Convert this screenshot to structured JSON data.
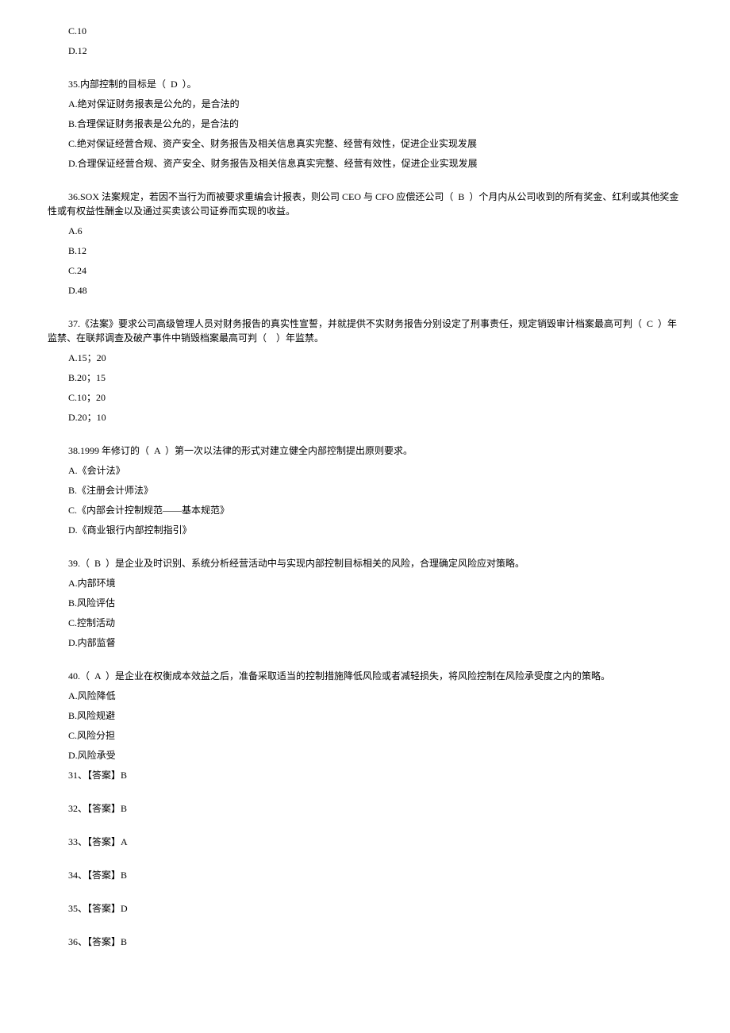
{
  "lines": [
    {
      "text": "C.10",
      "indent": true
    },
    {
      "text": "D.12",
      "indent": true
    },
    {
      "text": "",
      "gap": true
    },
    {
      "text": "35.内部控制的目标是（  D  ）。",
      "indent": true
    },
    {
      "text": "A.绝对保证财务报表是公允的，是合法的",
      "indent": true
    },
    {
      "text": "B.合理保证财务报表是公允的，是合法的",
      "indent": true
    },
    {
      "text": "C.绝对保证经营合规、资产安全、财务报告及相关信息真实完整、经营有效性，促进企业实现发展",
      "indent": true
    },
    {
      "text": "D.合理保证经营合规、资产安全、财务报告及相关信息真实完整、经营有效性，促进企业实现发展",
      "indent": true
    },
    {
      "text": "",
      "gap": true
    },
    {
      "text": "36.SOX 法案规定，若因不当行为而被要求重编会计报表，则公司 CEO 与 CFO 应偿还公司（  B  ）个月内从公司收到的所有奖金、红利或其他奖金性或有权益性酬金以及通过买卖该公司证券而实现的收益。",
      "indent": true,
      "wrap": true
    },
    {
      "text": "A.6",
      "indent": true
    },
    {
      "text": "B.12",
      "indent": true
    },
    {
      "text": "C.24",
      "indent": true
    },
    {
      "text": "D.48",
      "indent": true
    },
    {
      "text": "",
      "gap": true
    },
    {
      "text": "37.《法案》要求公司高级管理人员对财务报告的真实性宣誓，并就提供不实财务报告分别设定了刑事责任，规定销毁审计档案最高可判（  C  ）年监禁、在联邦调查及破产事件中销毁档案最高可判（    ）年监禁。",
      "indent": true,
      "wrap": true
    },
    {
      "text": "A.15；20",
      "indent": true
    },
    {
      "text": "B.20；15",
      "indent": true
    },
    {
      "text": "C.10；20",
      "indent": true
    },
    {
      "text": "D.20；10",
      "indent": true
    },
    {
      "text": "",
      "gap": true
    },
    {
      "text": "38.1999 年修订的（  A  ）第一次以法律的形式对建立健全内部控制提出原则要求。",
      "indent": true
    },
    {
      "text": "A.《会计法》",
      "indent": true
    },
    {
      "text": "B.《注册会计师法》",
      "indent": true
    },
    {
      "text": "C.《内部会计控制规范——基本规范》",
      "indent": true
    },
    {
      "text": "D.《商业银行内部控制指引》",
      "indent": true
    },
    {
      "text": "",
      "gap": true
    },
    {
      "text": "39.（  B  ）是企业及时识别、系统分析经营活动中与实现内部控制目标相关的风险，合理确定风险应对策略。",
      "indent": true
    },
    {
      "text": "A.内部环境",
      "indent": true
    },
    {
      "text": "B.风险评估",
      "indent": true
    },
    {
      "text": "C.控制活动",
      "indent": true
    },
    {
      "text": "D.内部监督",
      "indent": true
    },
    {
      "text": "",
      "gap": true
    },
    {
      "text": "40.（  A  ）是企业在权衡成本效益之后，准备采取适当的控制措施降低风险或者减轻损失，将风险控制在风险承受度之内的策略。",
      "indent": true
    },
    {
      "text": "A.风险降低",
      "indent": true
    },
    {
      "text": "B.风险规避",
      "indent": true
    },
    {
      "text": "C.风险分担",
      "indent": true
    },
    {
      "text": "D.风险承受",
      "indent": true
    },
    {
      "text": "31、【答案】B",
      "indent": true
    },
    {
      "text": "",
      "gap": true
    },
    {
      "text": "32、【答案】B",
      "indent": true
    },
    {
      "text": "",
      "gap": true
    },
    {
      "text": "33、【答案】A",
      "indent": true
    },
    {
      "text": "",
      "gap": true
    },
    {
      "text": "34、【答案】B",
      "indent": true
    },
    {
      "text": "",
      "gap": true
    },
    {
      "text": "35、【答案】D",
      "indent": true
    },
    {
      "text": "",
      "gap": true
    },
    {
      "text": "36、【答案】B",
      "indent": true
    }
  ]
}
